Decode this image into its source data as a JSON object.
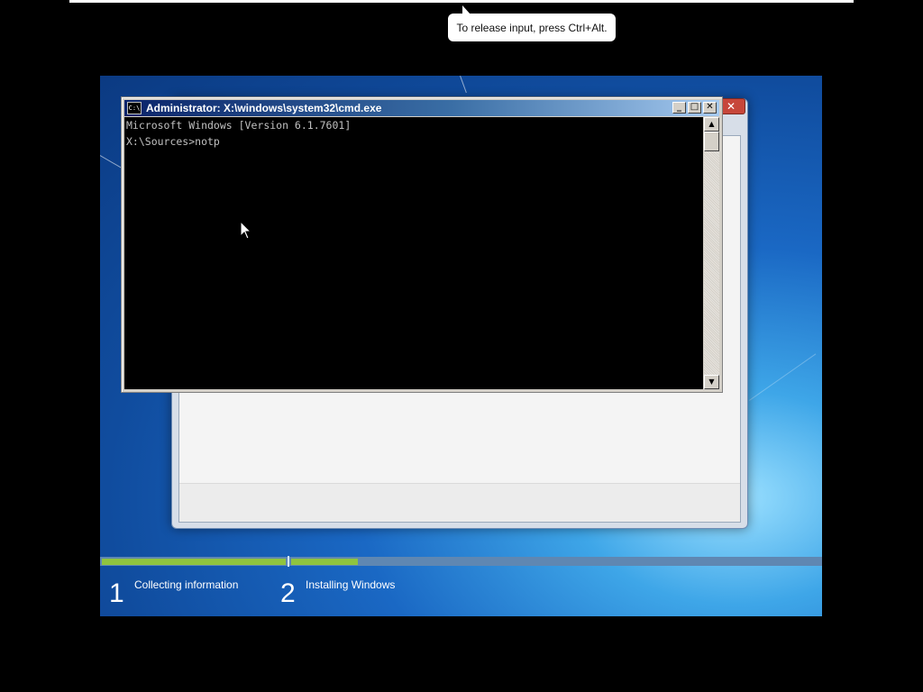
{
  "host": {
    "tooltip_text": "To release input, press Ctrl+Alt."
  },
  "cmd": {
    "title": "Administrator: X:\\windows\\system32\\cmd.exe",
    "icon_text": "C:\\",
    "minimize_glyph": "_",
    "maximize_glyph": "□",
    "close_glyph": "✕",
    "lines": [
      "Microsoft Windows [Version 6.1.7601]",
      "",
      "X:\\Sources>notp"
    ]
  },
  "setup": {
    "close_glyph": "✕",
    "steps": [
      {
        "number": "1",
        "label": "Collecting information"
      },
      {
        "number": "2",
        "label": "Installing Windows"
      }
    ]
  }
}
